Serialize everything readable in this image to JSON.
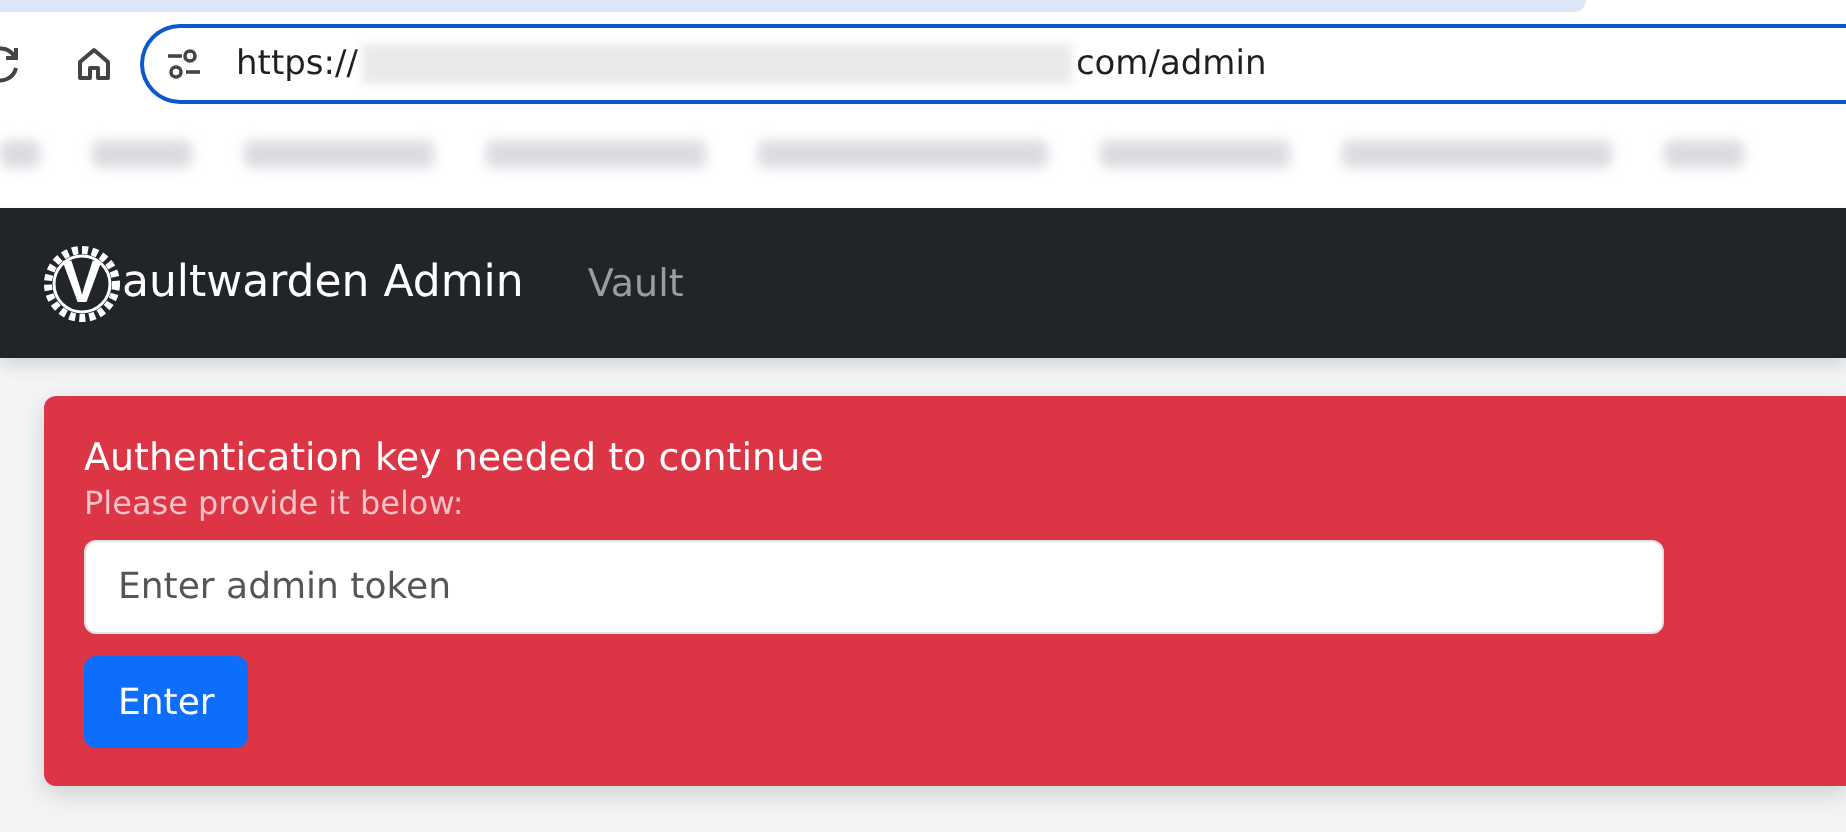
{
  "browser": {
    "address_bar": {
      "scheme": "https://",
      "redacted": true,
      "path": "com/admin"
    }
  },
  "navbar": {
    "logo_letter": "V",
    "brand": "aultwarden Admin",
    "links": [
      {
        "label": "Vault",
        "selected": false
      }
    ]
  },
  "alert": {
    "title": "Authentication key needed to continue",
    "message": "Please provide it below:",
    "token_field": {
      "placeholder": "Enter admin token"
    },
    "submit_button": "Enter"
  }
}
